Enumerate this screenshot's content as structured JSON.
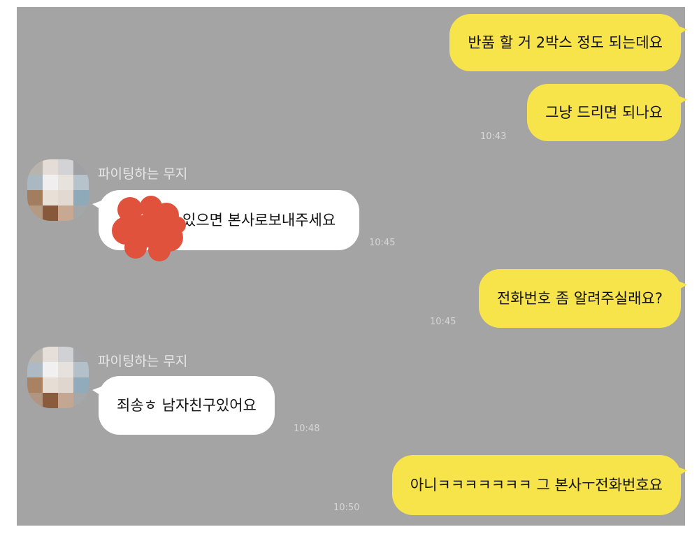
{
  "colors": {
    "background": "#a4a4a4",
    "my_bubble": "#f7e34a",
    "their_bubble": "#ffffff",
    "redaction": "#e0523c"
  },
  "messages": [
    {
      "text": "반품 할 거 2박스 정도 되는데요"
    },
    {
      "text": "그냥 드리면 되나요",
      "time": "10:43"
    },
    {
      "sender": "파이팅하는 무지",
      "text": "있으면 본사로보내주세요",
      "time": "10:45"
    },
    {
      "text": "전화번호 좀 알려주실래요?",
      "time": "10:45"
    },
    {
      "sender": "파이팅하는 무지",
      "text": "죄송ㅎ 남자친구있어요",
      "time": "10:48"
    },
    {
      "text": "아니ㅋㅋㅋㅋㅋㅋㅋ 그 본사ㅜ전화번호요",
      "time": "10:50"
    }
  ],
  "avatar_icon": "pixelated-avatar-icon"
}
